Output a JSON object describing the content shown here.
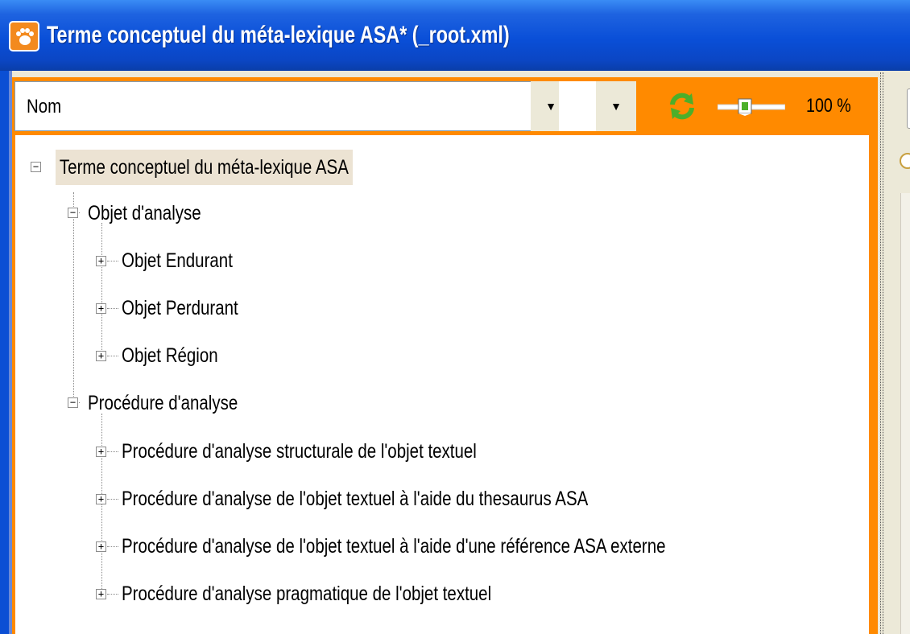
{
  "window": {
    "title": "Terme conceptuel du méta-lexique ASA* (_root.xml)",
    "icon": "paw-app-icon"
  },
  "toolbar": {
    "combo_value": "Nom",
    "combo2_value": "",
    "zoom_text": "100 %",
    "refresh_icon": "refresh-icon",
    "zoom_level": 100
  },
  "tree": {
    "root": "Terme conceptuel du méta-lexique ASA",
    "group1": {
      "label": "Objet d'analyse",
      "items": [
        "Objet Endurant",
        "Objet Perdurant",
        "Objet Région"
      ]
    },
    "group2": {
      "label": "Procédure d'analyse",
      "items": [
        "Procédure d'analyse structurale de l'objet textuel",
        "Procédure d'analyse de l'objet textuel à l'aide du thesaurus ASA",
        "Procédure d'analyse de l'objet textuel à l'aide d'une référence ASA externe",
        "Procédure d'analyse pragmatique de l'objet textuel"
      ]
    }
  },
  "colors": {
    "titlebar": "#0b4fd8",
    "accent": "#ff8a00",
    "root_highlight": "#ece3d3"
  }
}
